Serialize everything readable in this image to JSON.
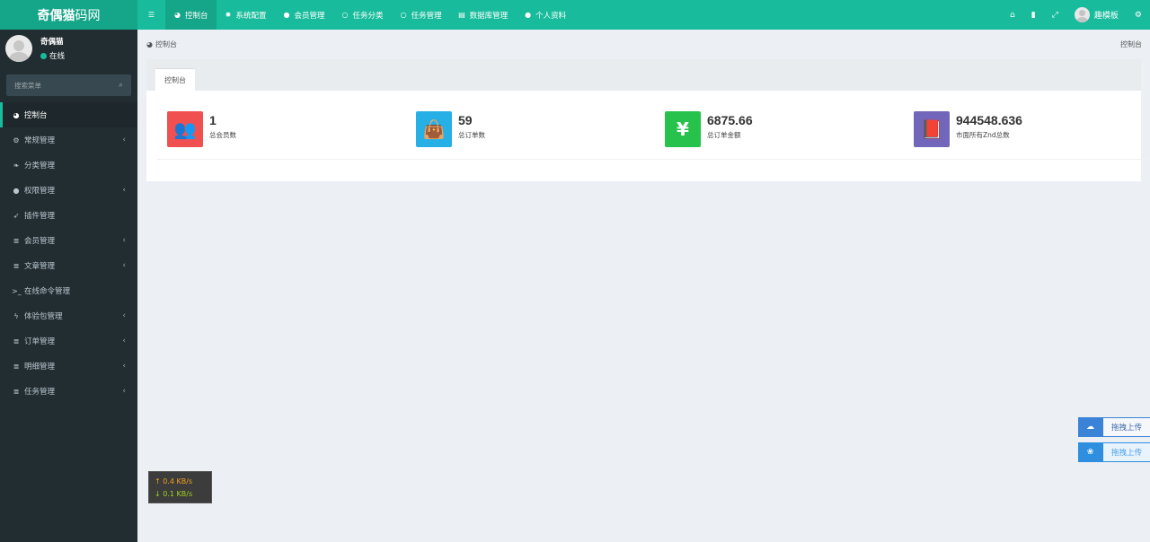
{
  "logo": {
    "bold": "奇偶猫",
    "light": "码网"
  },
  "topnav": {
    "toggle_icon": "hamburger-icon",
    "items": [
      {
        "label": "控制台",
        "icon": "dashboard-icon"
      },
      {
        "label": "系统配置",
        "icon": "gear-icon"
      },
      {
        "label": "会员管理",
        "icon": "user-icon"
      },
      {
        "label": "任务分类",
        "icon": "circle-icon"
      },
      {
        "label": "任务管理",
        "icon": "circle-icon"
      },
      {
        "label": "数据库管理",
        "icon": "database-icon"
      },
      {
        "label": "个人资料",
        "icon": "user-icon"
      }
    ],
    "right": {
      "username": "趣模板"
    }
  },
  "sidebar": {
    "user": {
      "name": "奇偶猫",
      "status": "在线"
    },
    "search": {
      "placeholder": "搜索菜单"
    },
    "items": [
      {
        "label": "控制台"
      },
      {
        "label": "常规管理"
      },
      {
        "label": "分类管理"
      },
      {
        "label": "权限管理"
      },
      {
        "label": "插件管理"
      },
      {
        "label": "会员管理"
      },
      {
        "label": "文章管理"
      },
      {
        "label": "在线命令管理"
      },
      {
        "label": "体验包管理"
      },
      {
        "label": "订单管理"
      },
      {
        "label": "明细管理"
      },
      {
        "label": "任务管理"
      }
    ]
  },
  "breadcrumb": {
    "current": "控制台",
    "right": "控制台"
  },
  "panel": {
    "tab": "控制台"
  },
  "stats": [
    {
      "value": "1",
      "label": "总会员数",
      "color": "#f05050",
      "icon": "users-icon"
    },
    {
      "value": "59",
      "label": "总订单数",
      "color": "#27b0e6",
      "icon": "shopping-bag-icon"
    },
    {
      "value": "6875.66",
      "label": "总订单金额",
      "color": "#27c24c",
      "icon": "yen-icon"
    },
    {
      "value": "944548.636",
      "label": "市面所有Znd总数",
      "color": "#7266ba",
      "icon": "book-icon"
    }
  ],
  "netspeed": {
    "up": "0.4 KB/s",
    "down": "0.1 KB/s"
  },
  "uploader": [
    {
      "label": "拖拽上传",
      "icon": "cloud-icon"
    },
    {
      "label": "拖拽上传",
      "icon": "baidu-cloud-icon"
    }
  ]
}
